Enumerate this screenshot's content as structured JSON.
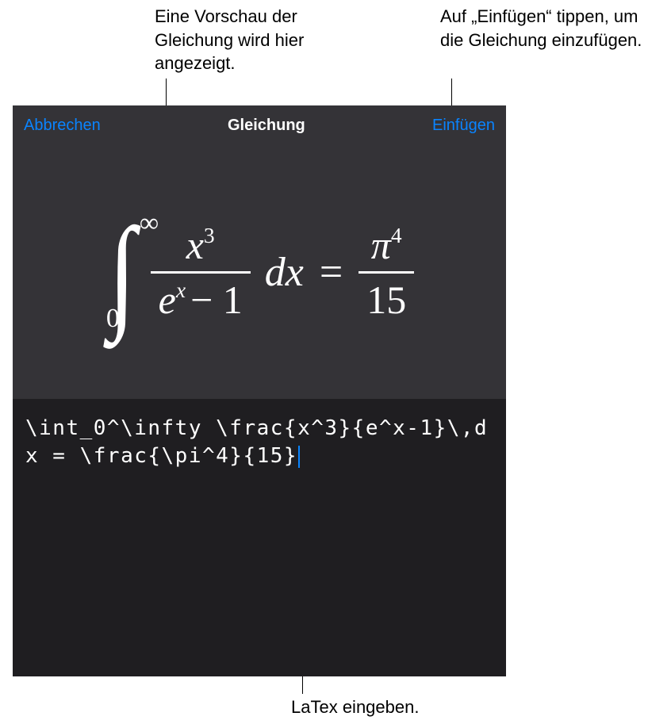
{
  "callouts": {
    "preview": "Eine Vorschau der Gleichung wird hier angezeigt.",
    "insert": "Auf „Einfügen“ tippen, um die Gleichung einzufügen.",
    "latex": "LaTex eingeben."
  },
  "header": {
    "cancel_label": "Abbrechen",
    "title": "Gleichung",
    "insert_label": "Einfügen"
  },
  "equation_preview": {
    "integral_lower": "0",
    "integral_upper": "∞",
    "frac1_num_base": "x",
    "frac1_num_exp": "3",
    "frac1_den_base": "e",
    "frac1_den_exp": "x",
    "frac1_den_rest": "− 1",
    "differential": "dx",
    "equals": "=",
    "frac2_num_base": "π",
    "frac2_num_exp": "4",
    "frac2_den": "15"
  },
  "latex_input": "\\int_0^\\infty \\frac{x^3}{e^x-1}\\,dx = \\frac{\\pi^4}{15}"
}
